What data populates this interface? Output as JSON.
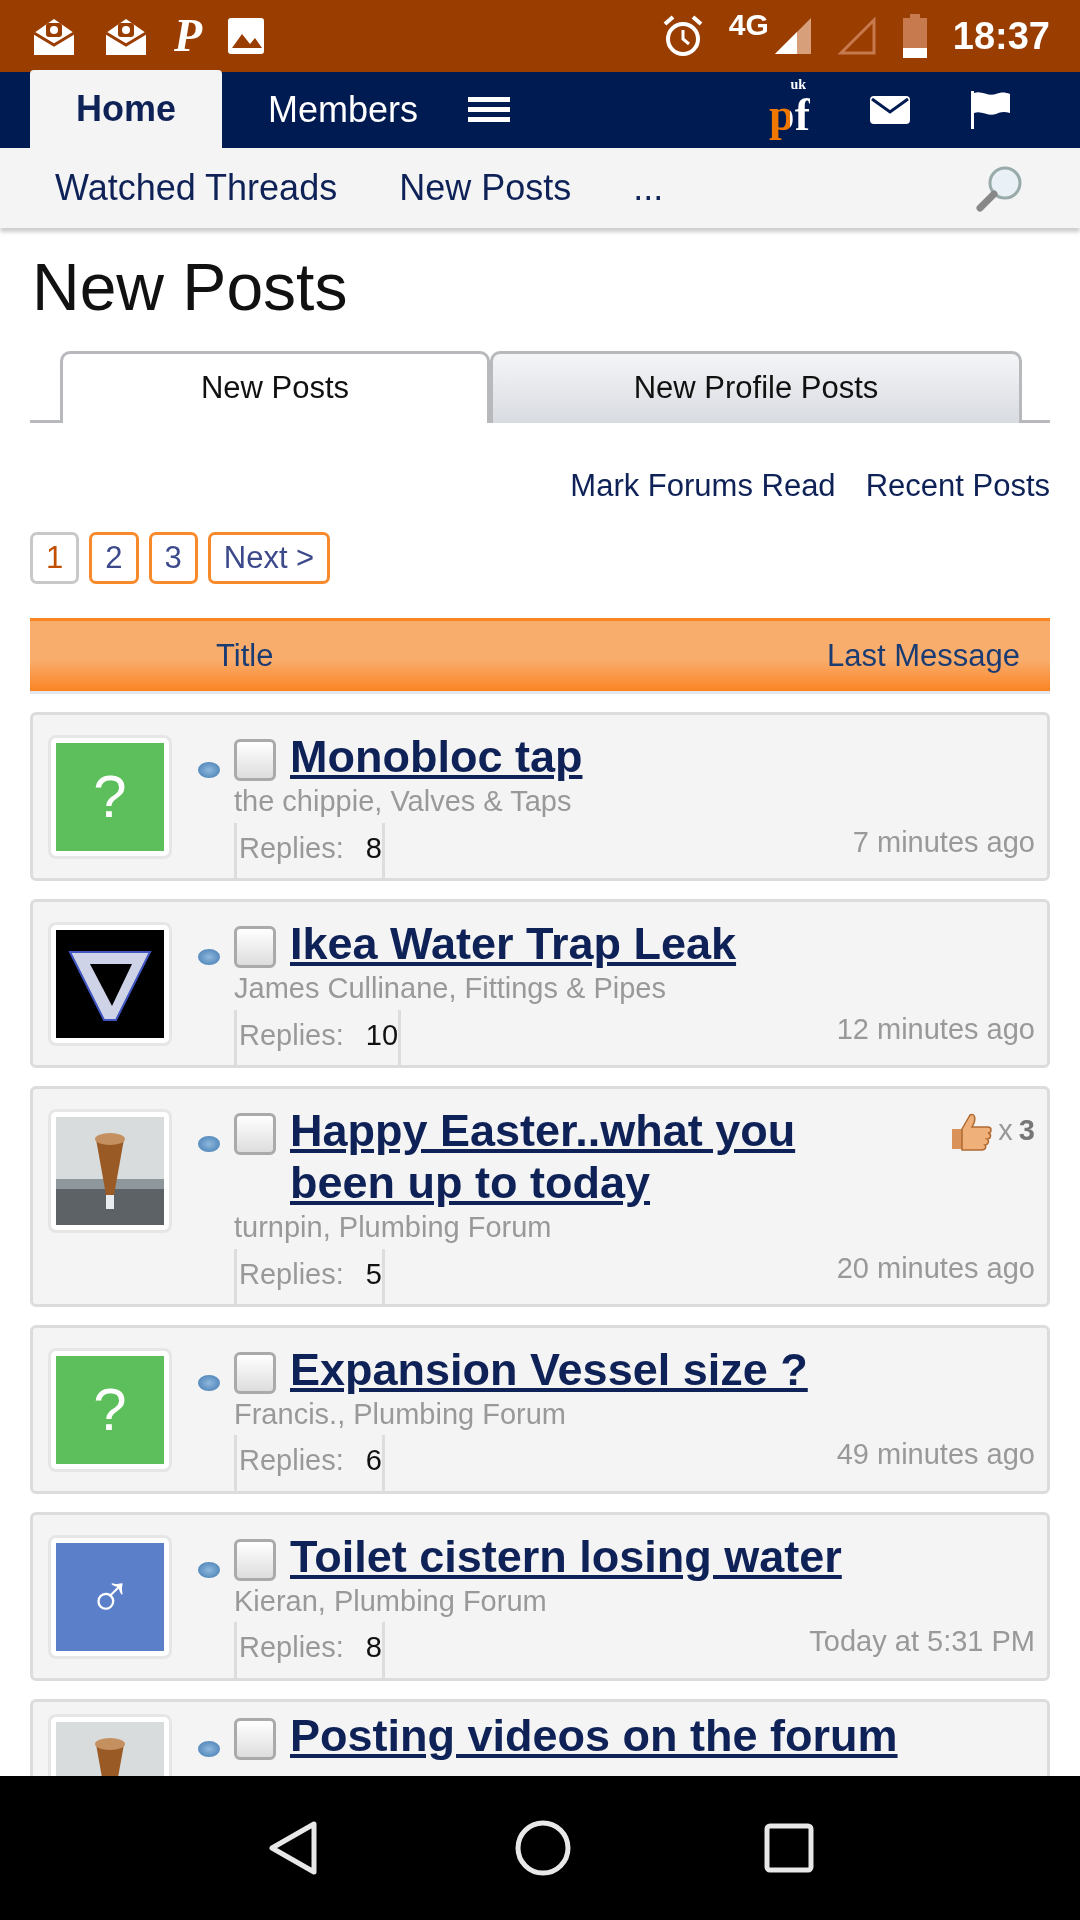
{
  "status_bar": {
    "app_letter": "P",
    "network": "4G",
    "time": "18:37"
  },
  "navbar": {
    "tabs": [
      {
        "label": "Home",
        "selected": true
      },
      {
        "label": "Members",
        "selected": false
      }
    ],
    "logo_small": "uk",
    "logo_big": "pf"
  },
  "subnav": {
    "links": [
      "Watched Threads",
      "New Posts",
      "..."
    ]
  },
  "page_title": "New Posts",
  "tabs": [
    {
      "label": "New Posts",
      "selected": true
    },
    {
      "label": "New Profile Posts",
      "selected": false
    }
  ],
  "links": [
    "Mark Forums Read",
    "Recent Posts"
  ],
  "pagination": [
    {
      "label": "1",
      "selected": true
    },
    {
      "label": "2",
      "selected": false
    },
    {
      "label": "3",
      "selected": false
    },
    {
      "label": "Next >",
      "selected": false
    }
  ],
  "table": {
    "columns": [
      "Title",
      "Last Message"
    ],
    "rows": [
      {
        "avatar": {
          "kind": "symbol",
          "symbol": "?",
          "color": "#5cbf5c"
        },
        "checked": false,
        "title": "Monobloc tap",
        "meta": "the chippie, Valves & Taps",
        "replies_label": "Replies:",
        "replies": "8",
        "last": "7 minutes ago"
      },
      {
        "avatar": {
          "kind": "logo"
        },
        "checked": false,
        "title": "Ikea Water Trap Leak",
        "meta": "James Cullinane, Fittings & Pipes",
        "replies_label": "Replies:",
        "replies": "10",
        "last": "12 minutes ago"
      },
      {
        "checked": false,
        "title": "Happy Easter..what you been up to today",
        "likes": "x",
        "likes_count": "3",
        "meta": "turnpin, Plumbing Forum",
        "replies_label": "Replies:",
        "replies": "5",
        "last": "20 minutes ago"
      },
      {
        "avatar": {
          "kind": "symbol",
          "symbol": "?",
          "color": "#5cbf5c"
        },
        "checked": false,
        "title": "Expansion Vessel size ?",
        "meta": "Francis., Plumbing Forum",
        "replies_label": "Replies:",
        "replies": "6",
        "last": "49 minutes ago"
      },
      {
        "avatar": {
          "kind": "symbol",
          "symbol": "♂",
          "color": "#5b7fc9"
        },
        "checked": false,
        "title": "Toilet cistern losing water",
        "meta": "Kieran, Plumbing Forum",
        "replies_label": "Replies:",
        "replies": "8",
        "last": "Today at 5:31 PM"
      },
      {
        "checked": false,
        "title": "Posting videos on the forum"
      }
    ]
  }
}
